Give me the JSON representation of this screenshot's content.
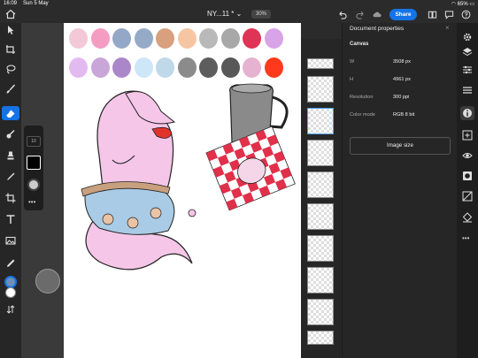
{
  "status": {
    "time": "16:09",
    "date": "Sun 5 May",
    "battery": "65%"
  },
  "document": {
    "name": "NY...11 *",
    "zoom": "30%"
  },
  "topbar": {
    "share_label": "Share"
  },
  "tools": {
    "brush_size": "10",
    "more": "•••"
  },
  "properties": {
    "title": "Document properties",
    "section": "Canvas",
    "rows": [
      {
        "label": "W",
        "value": "3508 px"
      },
      {
        "label": "H",
        "value": "4961 px"
      },
      {
        "label": "Resolution",
        "value": "300 ppi"
      },
      {
        "label": "Color mode",
        "value": "RGB  8 bit"
      }
    ],
    "image_size_label": "Image size"
  },
  "palette": [
    "#f3c9d7",
    "#f59cc3",
    "#93a8c6",
    "#95aac7",
    "#d8a07e",
    "#f6c6a2",
    "#b9b9b9",
    "#a8a8a8",
    "#e03456",
    "#d9a3e8",
    "#e3baf0",
    "#c9a6d8",
    "#a987c9",
    "#cde6f8",
    "#bfd9e8",
    "#8b8b8b",
    "#5d5d5d",
    "#585858",
    "#e6b2d1",
    "#ff3a1c"
  ],
  "colors": {
    "accent": "#1473e6",
    "canvas_bg": "#3a3a3a",
    "panel": "#262626"
  }
}
